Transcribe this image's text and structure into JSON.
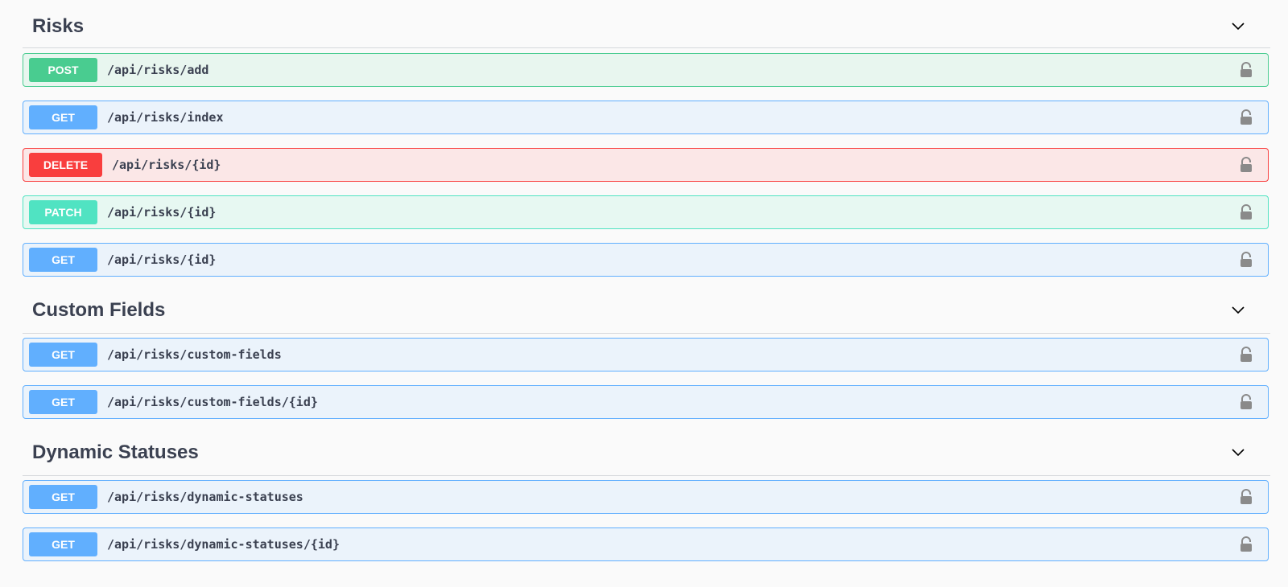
{
  "sections": [
    {
      "title": "Risks",
      "operations": [
        {
          "method": "POST",
          "path": "/api/risks/add"
        },
        {
          "method": "GET",
          "path": "/api/risks/index"
        },
        {
          "method": "DELETE",
          "path": "/api/risks/{id}"
        },
        {
          "method": "PATCH",
          "path": "/api/risks/{id}"
        },
        {
          "method": "GET",
          "path": "/api/risks/{id}"
        }
      ]
    },
    {
      "title": "Custom Fields",
      "operations": [
        {
          "method": "GET",
          "path": "/api/risks/custom-fields"
        },
        {
          "method": "GET",
          "path": "/api/risks/custom-fields/{id}"
        }
      ]
    },
    {
      "title": "Dynamic Statuses",
      "operations": [
        {
          "method": "GET",
          "path": "/api/risks/dynamic-statuses"
        },
        {
          "method": "GET",
          "path": "/api/risks/dynamic-statuses/{id}"
        }
      ]
    }
  ],
  "colors": {
    "POST": "#49cc90",
    "GET": "#61affe",
    "DELETE": "#f93e3e",
    "PATCH": "#50e3c2",
    "text": "#3b4151",
    "lock": "#8a8a8a"
  },
  "icons": {
    "section_toggle": "chevron-down-icon",
    "auth": "lock-icon"
  }
}
